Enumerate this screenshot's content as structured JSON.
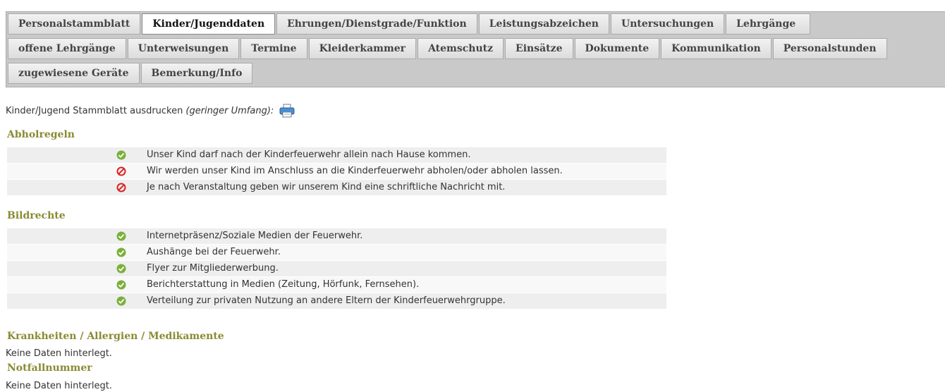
{
  "tabs": {
    "row1": [
      "Personalstammblatt",
      "Kinder/Jugenddaten",
      "Ehrungen/Dienstgrade/Funktion",
      "Leistungsabzeichen",
      "Untersuchungen",
      "Lehrgänge"
    ],
    "row2": [
      "offene Lehrgänge",
      "Unterweisungen",
      "Termine",
      "Kleiderkammer",
      "Atemschutz",
      "Einsätze",
      "Dokumente",
      "Kommunikation",
      "Personalstunden"
    ],
    "row3": [
      "zugewiesene Geräte",
      "Bemerkung/Info"
    ],
    "active": "Kinder/Jugenddaten"
  },
  "print": {
    "label": "Kinder/Jugend Stammblatt ausdrucken",
    "hint": "(geringer Umfang):",
    "icon": "printer-icon"
  },
  "sections": {
    "abholregeln": {
      "title": "Abholregeln",
      "items": [
        {
          "text": "Unser Kind darf nach der Kinderfeuerwehr allein nach Hause kommen.",
          "status": "yes"
        },
        {
          "text": "Wir werden unser Kind im Anschluss an die Kinderfeuerwehr abholen/oder abholen lassen.",
          "status": "no"
        },
        {
          "text": "Je nach Veranstaltung geben wir unserem Kind eine schriftliche Nachricht mit.",
          "status": "no"
        }
      ]
    },
    "bildrechte": {
      "title": "Bildrechte",
      "items": [
        {
          "text": "Internetpräsenz/Soziale Medien der Feuerwehr.",
          "status": "yes"
        },
        {
          "text": "Aushänge bei der Feuerwehr.",
          "status": "yes"
        },
        {
          "text": "Flyer zur Mitgliederwerbung.",
          "status": "yes"
        },
        {
          "text": "Berichterstattung in Medien (Zeitung, Hörfunk, Fernsehen).",
          "status": "yes"
        },
        {
          "text": "Verteilung zur privaten Nutzung an andere Eltern der Kinderfeuerwehrgruppe.",
          "status": "yes"
        }
      ]
    },
    "krankheiten": {
      "title": "Krankheiten / Allergien / Medikamente",
      "value": "Keine Daten hinterlegt."
    },
    "notfall": {
      "title": "Notfallnummer",
      "value": "Keine Daten hinterlegt."
    }
  },
  "colors": {
    "section_title": "#8a8a33",
    "yes_icon": "#7ab03a",
    "no_icon": "#dd2222"
  }
}
